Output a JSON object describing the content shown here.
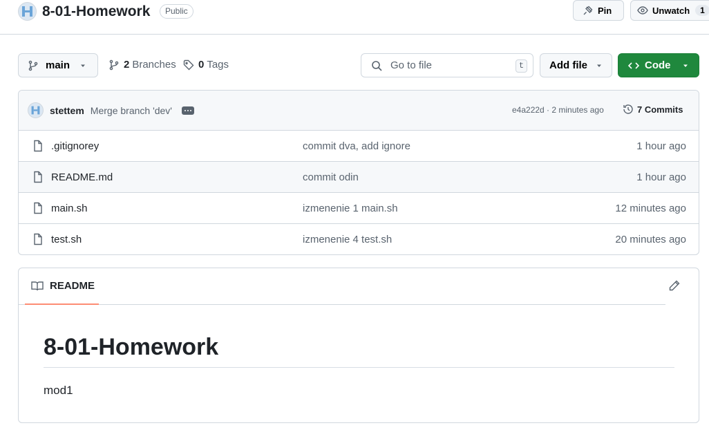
{
  "repo": {
    "title": "8-01-Homework",
    "visibility": "Public",
    "pin_label": "Pin",
    "watch_label": "Unwatch",
    "watch_count": "1"
  },
  "toolbar": {
    "branch": "main",
    "branches_count": "2",
    "branches_label": "Branches",
    "tags_count": "0",
    "tags_label": "Tags",
    "search_placeholder": "Go to file",
    "search_shortcut": "t",
    "add_file_label": "Add file",
    "code_label": "Code"
  },
  "latest_commit": {
    "author": "stettem",
    "message": "Merge branch 'dev'",
    "hash_time": "e4a222d · 2 minutes ago",
    "commits_label": "7 Commits"
  },
  "files": [
    {
      "name": ".gitignorey",
      "commit": "commit dva, add ignore",
      "time": "1 hour ago"
    },
    {
      "name": "README.md",
      "commit": "commit odin",
      "time": "1 hour ago"
    },
    {
      "name": "main.sh",
      "commit": "izmenenie 1 main.sh",
      "time": "12 minutes ago"
    },
    {
      "name": "test.sh",
      "commit": "izmenenie 4 test.sh",
      "time": "20 minutes ago"
    }
  ],
  "readme": {
    "tab_label": "README",
    "title": "8-01-Homework",
    "body": "mod1"
  },
  "colors": {
    "primary_button": "#1f883d",
    "active_tab_underline": "#fd8c73",
    "border": "#d0d7de",
    "muted_text": "#59636e"
  },
  "icons": {
    "pin": "pin-icon",
    "watch": "eye-icon",
    "branch": "git-branch-icon",
    "tag": "tag-icon",
    "search": "search-icon",
    "code": "code-icon",
    "history": "history-icon",
    "file": "file-icon",
    "book": "book-icon",
    "edit": "pencil-icon"
  }
}
